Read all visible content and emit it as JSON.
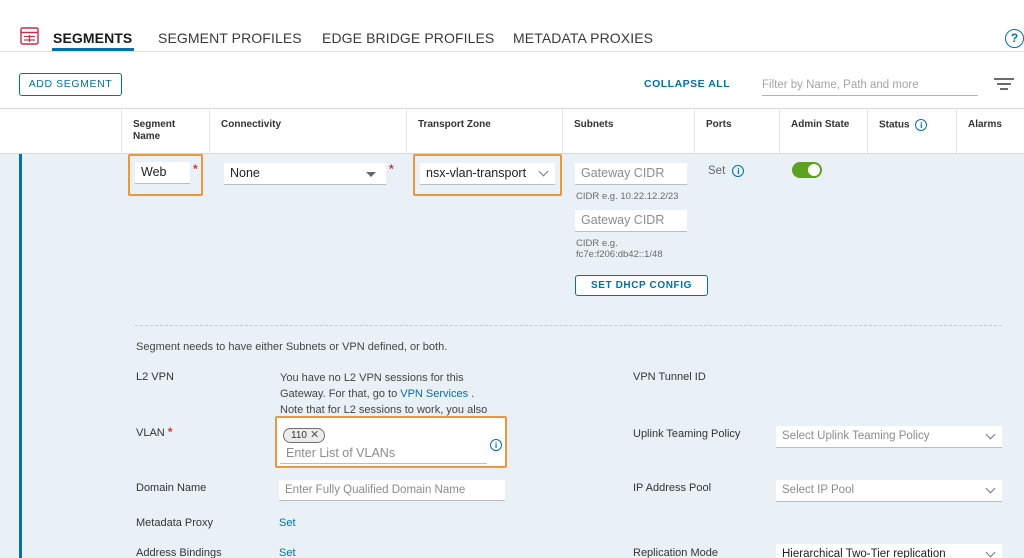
{
  "tabs": [
    "SEGMENTS",
    "SEGMENT PROFILES",
    "EDGE BRIDGE PROFILES",
    "METADATA PROXIES"
  ],
  "help_glyph": "?",
  "toolbar": {
    "add_label": "ADD SEGMENT",
    "collapse_label": "COLLAPSE ALL",
    "filter_placeholder": "Filter by Name, Path and more"
  },
  "columns": {
    "segment_name_1": "Segment",
    "segment_name_2": "Name",
    "connectivity": "Connectivity",
    "transport_zone": "Transport Zone",
    "subnets": "Subnets",
    "ports": "Ports",
    "admin_state": "Admin State",
    "status": "Status",
    "alarms": "Alarms"
  },
  "row": {
    "segment_name": "Web",
    "required_mark": "*",
    "connectivity": "None",
    "transport_zone": "nsx-vlan-transport",
    "gateway_ipv4_placeholder": "Gateway CIDR",
    "gateway_ipv4_hint": "CIDR e.g. 10.22.12.2/23",
    "gateway_ipv6_placeholder": "Gateway CIDR",
    "gateway_ipv6_hint_1": "CIDR e.g.",
    "gateway_ipv6_hint_2": "fc7e:f206:db42::1/48",
    "dhcp_button": "SET DHCP CONFIG",
    "ports_label": "Set",
    "admin_state_on": true
  },
  "details": {
    "message": "Segment needs to have either Subnets or VPN defined, or both.",
    "l2vpn_label": "L2 VPN",
    "l2vpn_text_1": "You have no L2 VPN sessions for this",
    "l2vpn_text_2a": "Gateway. For that, go to ",
    "l2vpn_link": "VPN Services",
    "l2vpn_text_2b": " .",
    "l2vpn_text_3": "Note that for L2 sessions to work, you also",
    "vpn_tunnel_label": "VPN Tunnel ID",
    "vlan_label": "VLAN",
    "vlan_chip": "110",
    "vlan_placeholder": "Enter List of VLANs",
    "uplink_label": "Uplink Teaming Policy",
    "uplink_placeholder": "Select Uplink Teaming Policy",
    "domain_label": "Domain Name",
    "domain_placeholder": "Enter Fully Qualified Domain Name",
    "ip_pool_label": "IP Address Pool",
    "ip_pool_placeholder": "Select IP Pool",
    "metadata_label": "Metadata Proxy",
    "metadata_set": "Set",
    "address_label": "Address Bindings",
    "address_set": "Set",
    "replication_label": "Replication Mode",
    "replication_value": "Hierarchical Two-Tier replication"
  },
  "colors": {
    "accent": "#0072a3",
    "highlight": "#e8983f",
    "toggle_on": "#5aa220",
    "required": "#d13438",
    "row_bg": "#e9f0f6"
  },
  "icons": [
    "segments-icon",
    "help-icon",
    "filter-icon",
    "info-icon",
    "dropdown-arrow-icon",
    "chevron-down-icon",
    "remove-chip-icon"
  ]
}
